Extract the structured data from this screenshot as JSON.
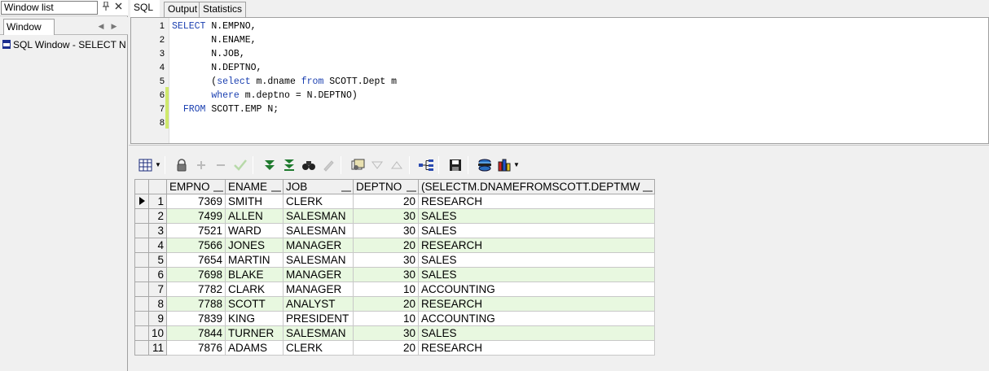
{
  "left_panel": {
    "title": "Window list",
    "pin_icon": "pin-icon",
    "close_icon": "close-icon",
    "tab_label": "Window list",
    "items": [
      {
        "label": "SQL Window - SELECT N.EI",
        "icon": "sql-window-icon"
      }
    ]
  },
  "tabs": [
    {
      "label": "SQL",
      "active": true
    },
    {
      "label": "Output",
      "active": false
    },
    {
      "label": "Statistics",
      "active": false
    }
  ],
  "editor": {
    "line_numbers": [
      "1",
      "2",
      "3",
      "4",
      "5",
      "6",
      "7",
      "8"
    ],
    "lines": [
      [
        {
          "t": "SELECT ",
          "k": true
        },
        {
          "t": "N.EMPNO,",
          "k": false
        }
      ],
      [
        {
          "t": "       N.ENAME,",
          "k": false
        }
      ],
      [
        {
          "t": "       N.JOB,",
          "k": false
        }
      ],
      [
        {
          "t": "       N.DEPTNO,",
          "k": false
        }
      ],
      [
        {
          "t": "       (",
          "k": false
        },
        {
          "t": "select ",
          "k": true
        },
        {
          "t": "m.dname ",
          "k": false
        },
        {
          "t": "from ",
          "k": true
        },
        {
          "t": "SCOTT.Dept m",
          "k": false
        }
      ],
      [
        {
          "t": "       ",
          "k": false
        },
        {
          "t": "where ",
          "k": true
        },
        {
          "t": "m.deptno = N.DEPTNO)",
          "k": false
        }
      ],
      [
        {
          "t": "  ",
          "k": false
        },
        {
          "t": "FROM ",
          "k": true
        },
        {
          "t": "SCOTT.EMP N;",
          "k": false
        }
      ],
      []
    ],
    "modified_lines": "5-7"
  },
  "toolbar": {
    "icons": [
      "grid-view-icon",
      "lock-icon",
      "add-record-icon",
      "delete-record-icon",
      "post-changes-icon",
      "fetch-next-icon",
      "fetch-last-icon",
      "find-icon",
      "clear-icon",
      "query-by-example-icon",
      "previous-icon",
      "next-icon",
      "query-plan-icon",
      "save-icon",
      "export-icon",
      "chart-icon"
    ]
  },
  "grid": {
    "columns": [
      "EMPNO",
      "ENAME",
      "JOB",
      "DEPTNO",
      "(SELECTM.DNAMEFROMSCOTT.DEPTMW"
    ],
    "rows": [
      [
        "1",
        "7369",
        "SMITH",
        "CLERK",
        "20",
        "RESEARCH"
      ],
      [
        "2",
        "7499",
        "ALLEN",
        "SALESMAN",
        "30",
        "SALES"
      ],
      [
        "3",
        "7521",
        "WARD",
        "SALESMAN",
        "30",
        "SALES"
      ],
      [
        "4",
        "7566",
        "JONES",
        "MANAGER",
        "20",
        "RESEARCH"
      ],
      [
        "5",
        "7654",
        "MARTIN",
        "SALESMAN",
        "30",
        "SALES"
      ],
      [
        "6",
        "7698",
        "BLAKE",
        "MANAGER",
        "30",
        "SALES"
      ],
      [
        "7",
        "7782",
        "CLARK",
        "MANAGER",
        "10",
        "ACCOUNTING"
      ],
      [
        "8",
        "7788",
        "SCOTT",
        "ANALYST",
        "20",
        "RESEARCH"
      ],
      [
        "9",
        "7839",
        "KING",
        "PRESIDENT",
        "10",
        "ACCOUNTING"
      ],
      [
        "10",
        "7844",
        "TURNER",
        "SALESMAN",
        "30",
        "SALES"
      ],
      [
        "11",
        "7876",
        "ADAMS",
        "CLERK",
        "20",
        "RESEARCH"
      ]
    ],
    "current_row": "1",
    "alt_row_color": "#e8f8e0"
  },
  "colors": {
    "keyword": "#1a3fb0",
    "modified_bar": "#cfe86c"
  }
}
